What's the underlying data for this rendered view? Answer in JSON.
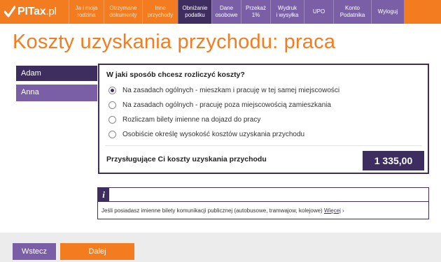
{
  "logo": {
    "brand": "PITax",
    "suffix": ".pl"
  },
  "nav": [
    {
      "label": "Ja i moja\nrodzina",
      "style": "orange"
    },
    {
      "label": "Otrzymane\ndokumenty",
      "style": "orange"
    },
    {
      "label": "Inne\nprzychody",
      "style": "orange"
    },
    {
      "label": "Obniżanie\npodatku",
      "style": "active"
    },
    {
      "label": "Dane\nosobowe",
      "style": "dark"
    },
    {
      "label": "Przekaż\n1%",
      "style": "dark"
    },
    {
      "label": "Wydruk\ni wysyłka",
      "style": "dark"
    },
    {
      "label": "UPO",
      "style": "dark"
    },
    {
      "label": "Konto\nPodatnika",
      "style": "dark"
    },
    {
      "label": "Wyloguj",
      "style": "dark"
    }
  ],
  "page": {
    "title": "Koszty uzyskania przychodu: praca"
  },
  "persons": [
    {
      "name": "Adam",
      "active": true
    },
    {
      "name": "Anna",
      "active": false
    }
  ],
  "form": {
    "question": "W jaki sposób chcesz rozliczyć koszty?",
    "options": [
      "Na zasadach ogólnych - mieszkam i pracuję w tej samej miejscowości",
      "Na zasadach ogólnych - pracuję poza miejscowością zamieszkania",
      "Rozliczam bilety imienne na dojazd do pracy",
      "Osobiście określę wysokość kosztów uzyskania przychodu"
    ],
    "selected_index": 0,
    "cost_label": "Przysługujące Ci koszty uzyskania przychodu",
    "cost_value": "1 335,00"
  },
  "info": {
    "icon": "i",
    "text": "Jeśli posiadasz imienne bilety komunikacji publicznej (autobusowe, tramwajow, kolejowe)",
    "link": "Więcej",
    "arrow": "›"
  },
  "buttons": {
    "back": "Wstecz",
    "next": "Dalej"
  },
  "colors": {
    "orange": "#f47c20",
    "dark_purple": "#3e2d5f",
    "light_purple": "#7a5fa6"
  }
}
